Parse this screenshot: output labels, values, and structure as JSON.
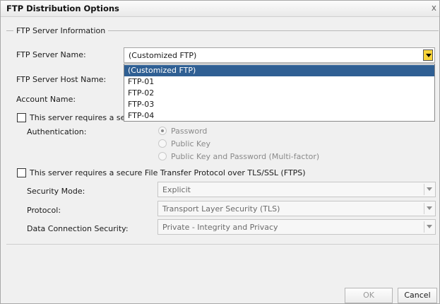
{
  "dialog": {
    "title": "FTP Distribution Options",
    "close_glyph": "x",
    "section_title": "FTP Server Information"
  },
  "fields": {
    "server_name_label": "FTP Server Name:",
    "server_name_value": "(Customized FTP)",
    "host_label": "FTP Server Host Name:",
    "account_label": "Account Name:",
    "sftp_checkbox_label": "This server requires a secu",
    "auth_label": "Authentication:",
    "ftps_checkbox_label": "This server requires a secure File Transfer Protocol over TLS/SSL (FTPS)",
    "security_mode_label": "Security Mode:",
    "security_mode_value": "Explicit",
    "protocol_label": "Protocol:",
    "protocol_value": "Transport Layer Security (TLS)",
    "data_conn_label": "Data Connection Security:",
    "data_conn_value": "Private - Integrity and Privacy"
  },
  "auth_options": [
    {
      "label": "Password",
      "selected": true
    },
    {
      "label": "Public Key",
      "selected": false
    },
    {
      "label": "Public Key and Password (Multi-factor)",
      "selected": false
    }
  ],
  "dropdown_options": [
    "(Customized FTP)",
    "FTP-01",
    "FTP-02",
    "FTP-03",
    "FTP-04"
  ],
  "buttons": {
    "ok": "OK",
    "cancel": "Cancel"
  },
  "colors": {
    "selection": "#2f5f93",
    "dropdown_button": "#f8d43a"
  }
}
